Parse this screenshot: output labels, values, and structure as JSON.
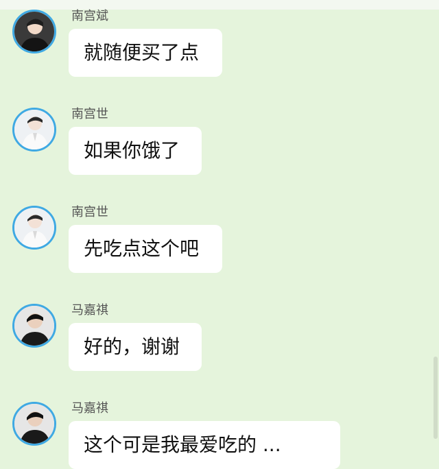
{
  "messages": [
    {
      "sender": "南宫斌",
      "text": "就随便买了点",
      "avatar": "avatar-nangong-bin"
    },
    {
      "sender": "南宫世",
      "text": "如果你饿了",
      "avatar": "avatar-nangong-shi"
    },
    {
      "sender": "南宫世",
      "text": "先吃点这个吧",
      "avatar": "avatar-nangong-shi"
    },
    {
      "sender": "马嘉祺",
      "text": "好的，谢谢",
      "avatar": "avatar-ma-jiaqi"
    },
    {
      "sender": "马嘉祺",
      "text": "这个可是我最爱吃的 ...",
      "avatar": "avatar-ma-jiaqi"
    }
  ],
  "colors": {
    "background": "#e5f4dc",
    "bubble": "#ffffff",
    "avatar_ring": "#3fa9e3"
  }
}
